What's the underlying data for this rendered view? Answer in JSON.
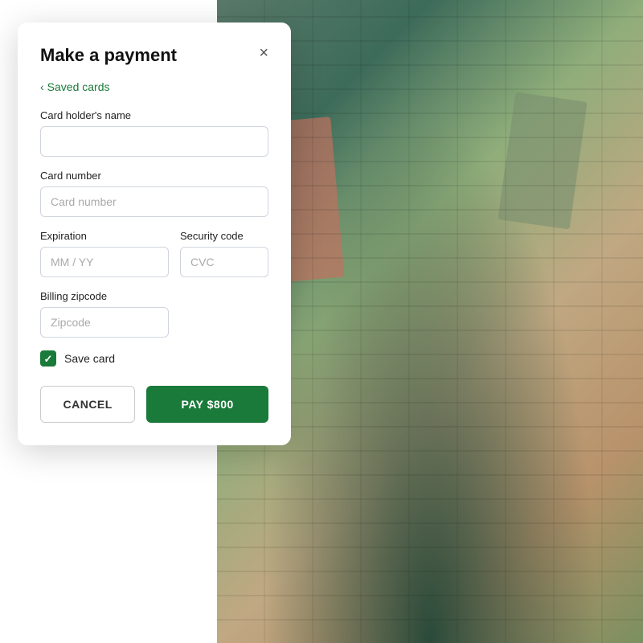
{
  "modal": {
    "title": "Make a payment",
    "close_label": "×",
    "saved_cards_label": "Saved cards",
    "fields": {
      "cardholder_label": "Card holder's name",
      "cardholder_placeholder": "",
      "card_number_label": "Card number",
      "card_number_placeholder": "Card number",
      "expiration_label": "Expiration",
      "expiration_placeholder": "MM / YY",
      "security_label": "Security code",
      "security_placeholder": "CVC",
      "zipcode_label": "Billing zipcode",
      "zipcode_placeholder": "Zipcode"
    },
    "save_card_label": "Save card",
    "cancel_label": "CANCEL",
    "pay_label": "PAY $800"
  }
}
